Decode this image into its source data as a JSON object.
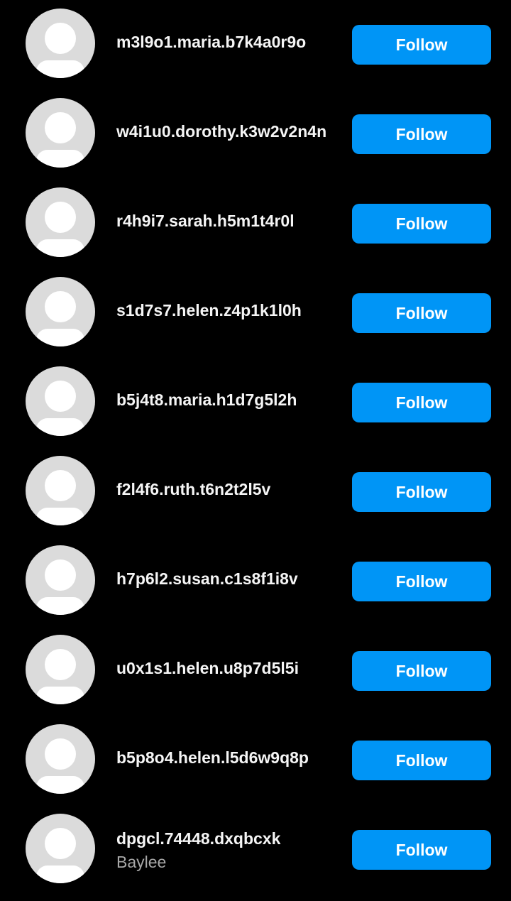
{
  "colors": {
    "background": "#000000",
    "follow_button": "#0095f6",
    "avatar_placeholder": "#dbdbdb",
    "username_text": "#f5f5f5",
    "secondary_text": "#a8a8a8"
  },
  "follow_label": "Follow",
  "users": [
    {
      "username": "m3l9o1.maria.b7k4a0r9o",
      "full_name": "",
      "avatar_icon": "default-avatar-icon"
    },
    {
      "username": "w4i1u0.dorothy.k3w2v2n4n",
      "full_name": "",
      "avatar_icon": "default-avatar-icon"
    },
    {
      "username": "r4h9i7.sarah.h5m1t4r0l",
      "full_name": "",
      "avatar_icon": "default-avatar-icon"
    },
    {
      "username": "s1d7s7.helen.z4p1k1l0h",
      "full_name": "",
      "avatar_icon": "default-avatar-icon"
    },
    {
      "username": "b5j4t8.maria.h1d7g5l2h",
      "full_name": "",
      "avatar_icon": "default-avatar-icon"
    },
    {
      "username": "f2l4f6.ruth.t6n2t2l5v",
      "full_name": "",
      "avatar_icon": "default-avatar-icon"
    },
    {
      "username": "h7p6l2.susan.c1s8f1i8v",
      "full_name": "",
      "avatar_icon": "default-avatar-icon"
    },
    {
      "username": "u0x1s1.helen.u8p7d5l5i",
      "full_name": "",
      "avatar_icon": "default-avatar-icon"
    },
    {
      "username": "b5p8o4.helen.l5d6w9q8p",
      "full_name": "",
      "avatar_icon": "default-avatar-icon"
    },
    {
      "username": "dpgcl.74448.dxqbcxk",
      "full_name": "Baylee",
      "avatar_icon": "default-avatar-icon"
    }
  ]
}
